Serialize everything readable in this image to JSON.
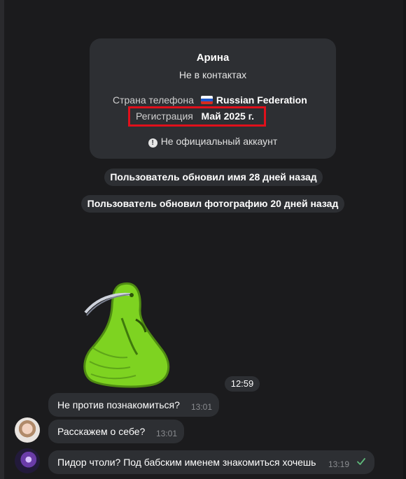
{
  "profile_card": {
    "name": "Арина",
    "contact_status": "Не в контактах",
    "phone_country_label": "Страна телефона",
    "phone_country_value": "Russian Federation",
    "registration_label": "Регистрация",
    "registration_value": "Май 2025 г.",
    "official_status": "Не официальный аккаунт"
  },
  "service_messages": [
    "Пользователь обновил имя 28 дней назад",
    "Пользователь обновил фотографию 20 дней назад"
  ],
  "sticker": {
    "time": "12:59"
  },
  "messages": [
    {
      "text": "Не против познакомиться?",
      "time": "13:01"
    },
    {
      "text": "Расскажем о себе?",
      "time": "13:01"
    },
    {
      "text": "Пидор чтоли? Под бабским именем знакомиться хочешь",
      "time": "13:19"
    }
  ],
  "colors": {
    "background": "#1b1b1d",
    "bubble": "#2d2f33",
    "highlight": "#e0101b",
    "check": "#5fb97a"
  }
}
